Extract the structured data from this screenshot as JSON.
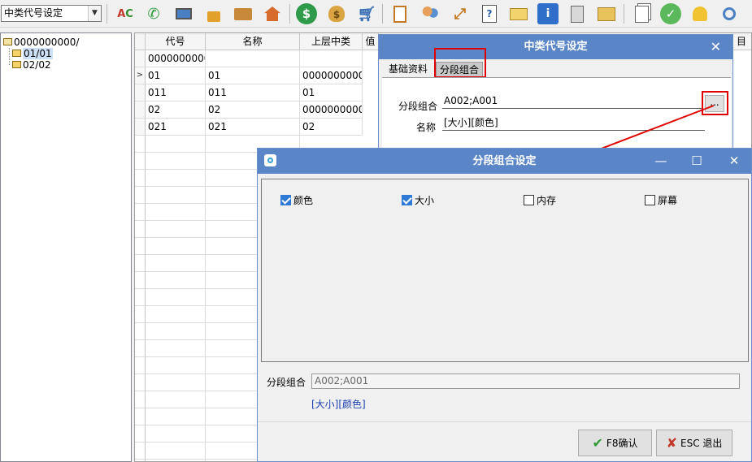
{
  "toolbar": {
    "module_select": "中类代号设定",
    "icons": [
      "abc-spellcheck-icon",
      "phone-icon",
      "monitor-icon",
      "lock-icon",
      "briefcase-icon",
      "home-icon",
      "dollar-coin-icon",
      "money-bag-icon",
      "shopping-cart-icon",
      "clipboard-icon",
      "users-icon",
      "transfer-icon",
      "help-document-icon",
      "envelope-icon",
      "info-icon",
      "calculator-icon",
      "folder-icon",
      "documents-icon",
      "check-icon",
      "bell-icon",
      "search-icon"
    ]
  },
  "tree": {
    "root": "0000000000/",
    "children": [
      "01/01",
      "02/02"
    ]
  },
  "grid": {
    "columns": [
      "代号",
      "名称",
      "上层中类",
      "值",
      "目"
    ],
    "rows": [
      [
        "0000000000",
        "",
        ""
      ],
      [
        "01",
        "01",
        "0000000000"
      ],
      [
        "011",
        "011",
        "01"
      ],
      [
        "02",
        "02",
        "0000000000"
      ],
      [
        "021",
        "021",
        "02"
      ]
    ]
  },
  "dialog_category": {
    "title": "中类代号设定",
    "close": "✕",
    "tabs": [
      "基础资料",
      "分段组合"
    ],
    "segment_label": "分段组合",
    "segment_value": "A002;A001",
    "browse": "...",
    "name_label": "名称",
    "name_value": "[大小][颜色]"
  },
  "dialog_segment": {
    "title": "分段组合设定",
    "minimize": "—",
    "maximize": "☐",
    "close": "✕",
    "options": [
      {
        "label": "颜色",
        "checked": true
      },
      {
        "label": "大小",
        "checked": true
      },
      {
        "label": "内存",
        "checked": false
      },
      {
        "label": "屏幕",
        "checked": false
      }
    ],
    "segment_label": "分段组合",
    "segment_value": "A002;A001",
    "name_preview": "[大小][颜色]",
    "confirm": "F8确认",
    "exit": "ESC 退出"
  },
  "colors": {
    "title_bar": "#5a86c8",
    "highlight": "#e00000",
    "link_text": "#1a3fb0"
  }
}
